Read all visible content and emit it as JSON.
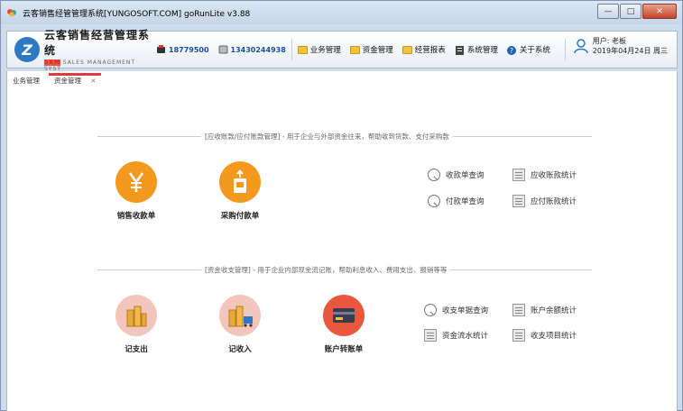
{
  "window": {
    "title": "云客销售经管管理系统[YUNGOSOFT.COM]  goRunLite v3.88",
    "controls": [
      "minimize",
      "maximize",
      "close"
    ]
  },
  "header": {
    "brand_cn": "云客销售经营管理系统",
    "brand_en_prefix": "SKM",
    "brand_en": "SALES MANAGEMENT SYST",
    "phone1": "18779500",
    "phone2": "13430244938",
    "menu": [
      {
        "label": "业务管理",
        "icon": "folder-icon"
      },
      {
        "label": "资金管理",
        "icon": "folder-icon"
      },
      {
        "label": "经营报表",
        "icon": "folder-icon"
      },
      {
        "label": "系统管理",
        "icon": "system-icon"
      },
      {
        "label": "关于系统",
        "icon": "help-icon"
      }
    ],
    "user_label": "用户: 老板",
    "date": "2019年04月24日 周三"
  },
  "tabs": [
    {
      "label": "业务管理",
      "active": false
    },
    {
      "label": "资金管理",
      "active": true
    }
  ],
  "sections": {
    "receivables": {
      "caption": "[应收账款/应付账款管理] - 用于企业与外部资金往来，帮助收到货款、支付采购款",
      "actions": [
        {
          "label": "销售收款单",
          "icon": "yen-icon"
        },
        {
          "label": "采购付款单",
          "icon": "payment-doc-icon"
        }
      ],
      "links": [
        {
          "label": "收款单查询",
          "icon": "search-icon"
        },
        {
          "label": "应收账款统计",
          "icon": "report-icon"
        },
        {
          "label": "付款单查询",
          "icon": "search-icon"
        },
        {
          "label": "应付账款统计",
          "icon": "report-icon"
        }
      ]
    },
    "cashflow": {
      "caption": "[资金收支管理] - 用于企业内部现金流记账，帮助利息收入、费用支出、报销等等",
      "actions": [
        {
          "label": "记支出",
          "icon": "coins-icon"
        },
        {
          "label": "记收入",
          "icon": "coins-cart-icon"
        },
        {
          "label": "账户转账单",
          "icon": "bank-card-icon"
        }
      ],
      "links": [
        {
          "label": "收支单据查询",
          "icon": "search-icon"
        },
        {
          "label": "账户余额统计",
          "icon": "report-icon"
        },
        {
          "label": "资金流水统计",
          "icon": "report-icon"
        },
        {
          "label": "收支项目统计",
          "icon": "report-icon"
        }
      ]
    }
  },
  "colors": {
    "accent_red": "#e23a3a",
    "orange": "#f39a1e",
    "pink": "#f2c6bd",
    "red_circle": "#e9573f",
    "phone_blue": "#1a4f9c"
  }
}
